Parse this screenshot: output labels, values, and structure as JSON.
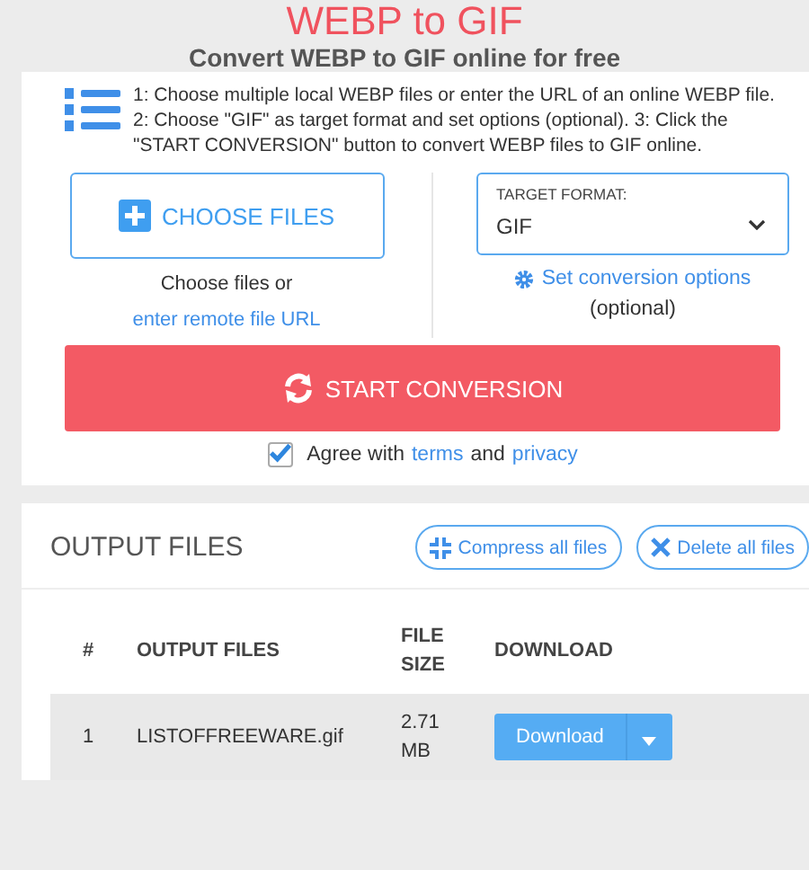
{
  "header": {
    "title": "WEBP to GIF",
    "subtitle": "Convert WEBP to GIF online for free"
  },
  "converter": {
    "instructions": "1: Choose multiple local WEBP files or enter the URL of an online WEBP file. 2: Choose \"GIF\" as target format and set options (optional). 3: Click the \"START CONVERSION\" button to convert WEBP files to GIF online.",
    "choose_button": "CHOOSE FILES",
    "choose_hint": "Choose files or",
    "remote_link": "enter remote file URL",
    "target_label": "TARGET FORMAT:",
    "target_value": "GIF",
    "options_link": "Set conversion options",
    "options_hint": "(optional)",
    "start_button": "START CONVERSION",
    "agree": {
      "checked": true,
      "text_before": "Agree with",
      "terms": "terms",
      "and": "and",
      "privacy": "privacy"
    }
  },
  "output": {
    "title": "OUTPUT FILES",
    "compress_button": "Compress all files",
    "delete_button": "Delete all files",
    "table": {
      "columns": [
        "#",
        "OUTPUT FILES",
        "FILE SIZE",
        "DOWNLOAD"
      ],
      "rows": [
        {
          "index": "1",
          "file": "LISTOFFREEWARE.gif",
          "size": "2.71 MB",
          "download": "Download"
        }
      ]
    }
  }
}
